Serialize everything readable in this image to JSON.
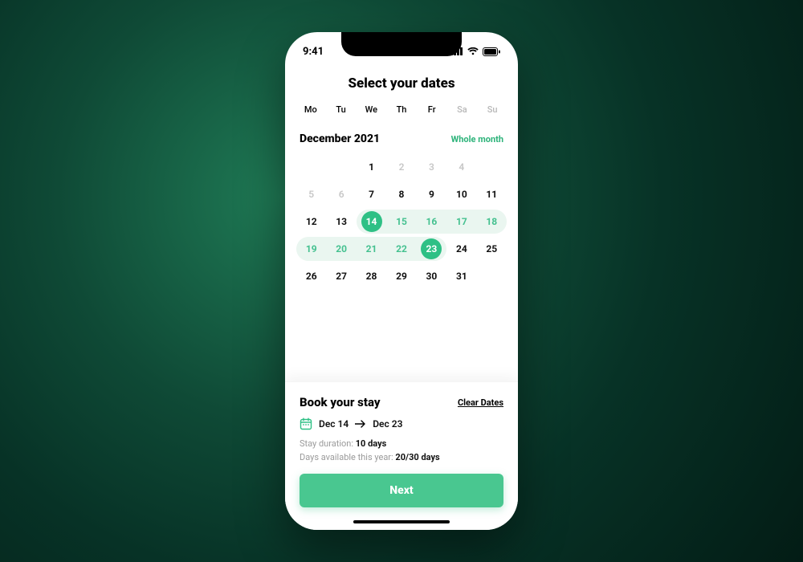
{
  "status": {
    "time": "9:41"
  },
  "header": {
    "title": "Select your dates"
  },
  "weekdays": [
    "Mo",
    "Tu",
    "We",
    "Th",
    "Fr",
    "Sa",
    "Su"
  ],
  "month": {
    "label": "December 2021",
    "whole_month": "Whole month"
  },
  "calendar": {
    "cells": [
      {
        "n": "",
        "k": "empty"
      },
      {
        "n": "",
        "k": "empty"
      },
      {
        "n": "1",
        "k": "norm"
      },
      {
        "n": "2",
        "k": "mute"
      },
      {
        "n": "3",
        "k": "mute"
      },
      {
        "n": "4",
        "k": "mute"
      },
      {
        "n": "",
        "k": "empty"
      },
      {
        "n": "5",
        "k": "mute"
      },
      {
        "n": "6",
        "k": "mute"
      },
      {
        "n": "7",
        "k": "norm"
      },
      {
        "n": "8",
        "k": "norm"
      },
      {
        "n": "9",
        "k": "norm"
      },
      {
        "n": "10",
        "k": "norm"
      },
      {
        "n": "11",
        "k": "norm"
      },
      {
        "n": "12",
        "k": "norm"
      },
      {
        "n": "13",
        "k": "norm"
      },
      {
        "n": "14",
        "k": "start",
        "edge": "left"
      },
      {
        "n": "15",
        "k": "in"
      },
      {
        "n": "16",
        "k": "in"
      },
      {
        "n": "17",
        "k": "in"
      },
      {
        "n": "18",
        "k": "in",
        "edge": "right"
      },
      {
        "n": "19",
        "k": "in",
        "edge": "left"
      },
      {
        "n": "20",
        "k": "in"
      },
      {
        "n": "21",
        "k": "in"
      },
      {
        "n": "22",
        "k": "in"
      },
      {
        "n": "23",
        "k": "end",
        "edge": "right"
      },
      {
        "n": "24",
        "k": "norm"
      },
      {
        "n": "25",
        "k": "norm"
      },
      {
        "n": "26",
        "k": "norm"
      },
      {
        "n": "27",
        "k": "norm"
      },
      {
        "n": "28",
        "k": "norm"
      },
      {
        "n": "29",
        "k": "norm"
      },
      {
        "n": "30",
        "k": "norm"
      },
      {
        "n": "31",
        "k": "norm"
      },
      {
        "n": "",
        "k": "empty"
      }
    ]
  },
  "booking": {
    "title": "Book your stay",
    "clear": "Clear Dates",
    "from": "Dec 14",
    "to": "Dec 23",
    "duration_label": "Stay duration: ",
    "duration_value": "10 days",
    "avail_label": "Days available this year: ",
    "avail_value": "20/30 days",
    "next": "Next"
  },
  "colors": {
    "accent": "#2ec085"
  }
}
